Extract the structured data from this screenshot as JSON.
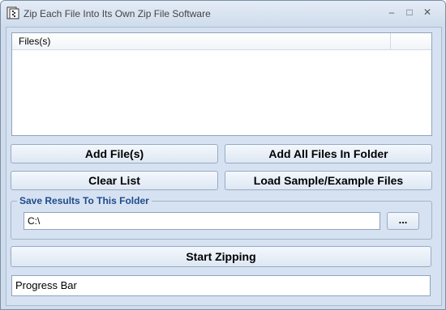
{
  "window": {
    "title": "Zip Each File Into Its Own Zip File Software",
    "minimize_label": "–",
    "maximize_label": "□",
    "close_label": "✕"
  },
  "file_list": {
    "column_header": "Files(s)",
    "rows": []
  },
  "buttons": {
    "add_files": "Add File(s)",
    "add_folder": "Add All Files In Folder",
    "clear_list": "Clear List",
    "load_sample": "Load Sample/Example Files",
    "start": "Start Zipping"
  },
  "save_results": {
    "label": "Save Results To This Folder",
    "folder_value": "C:\\",
    "browse_label": "..."
  },
  "progress": {
    "label": "Progress Bar"
  },
  "icons": {
    "app": "zip-app-icon"
  }
}
